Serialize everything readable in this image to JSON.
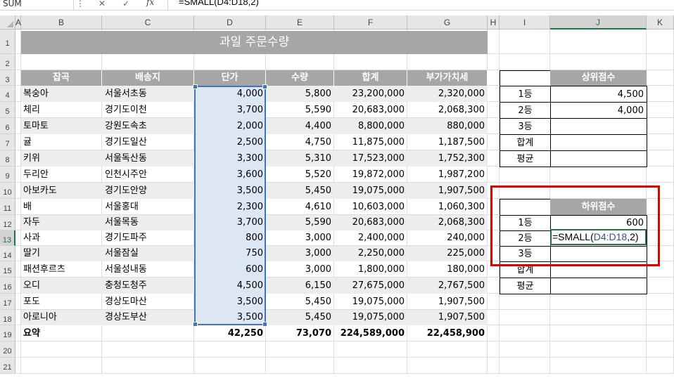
{
  "formula_bar": {
    "name_box": "SUM",
    "cancel": "✕",
    "enter": "✓",
    "fx": "fx",
    "formula": "=SMALL(D4:D18,2)"
  },
  "columns": [
    "A",
    "B",
    "C",
    "D",
    "E",
    "F",
    "G",
    "H",
    "I",
    "J",
    "K"
  ],
  "rows": [
    "1",
    "2",
    "3",
    "4",
    "5",
    "6",
    "7",
    "8",
    "9",
    "10",
    "11",
    "12",
    "13",
    "14",
    "15",
    "16",
    "17",
    "18",
    "19",
    "20",
    "21"
  ],
  "title": "과일 주문수량",
  "headers": [
    "잡곡",
    "배송지",
    "단가",
    "수량",
    "합계",
    "부가가치세"
  ],
  "table": [
    [
      "복숭아",
      "서울서초동",
      "4,000",
      "5,800",
      "23,200,000",
      "2,320,000"
    ],
    [
      "체리",
      "경기도이천",
      "3,700",
      "5,590",
      "20,683,000",
      "2,068,300"
    ],
    [
      "토마토",
      "강원도속초",
      "2,000",
      "4,400",
      "8,800,000",
      "880,000"
    ],
    [
      "귤",
      "경기도일산",
      "2,500",
      "4,750",
      "11,875,000",
      "1,187,500"
    ],
    [
      "키위",
      "서울독산동",
      "3,300",
      "5,310",
      "17,523,000",
      "1,752,300"
    ],
    [
      "두리안",
      "인천시주안",
      "3,600",
      "5,520",
      "19,872,000",
      "1,987,200"
    ],
    [
      "아보카도",
      "경기도안양",
      "3,500",
      "5,450",
      "19,075,000",
      "1,907,500"
    ],
    [
      "배",
      "서울홍대",
      "2,300",
      "4,610",
      "10,603,000",
      "1,060,300"
    ],
    [
      "자두",
      "서울목동",
      "3,700",
      "5,590",
      "20,683,000",
      "2,068,300"
    ],
    [
      "사과",
      "경기도파주",
      "800",
      "3,000",
      "2,400,000",
      "240,000"
    ],
    [
      "딸기",
      "서울잠실",
      "750",
      "3,000",
      "2,250,000",
      "225,000"
    ],
    [
      "패션후르츠",
      "서울성내동",
      "600",
      "3,000",
      "1,800,000",
      "180,000"
    ],
    [
      "오디",
      "충청도청주",
      "4,500",
      "6,150",
      "27,675,000",
      "2,767,500"
    ],
    [
      "포도",
      "경상도마산",
      "3,500",
      "5,450",
      "19,075,000",
      "1,907,500"
    ],
    [
      "아로니아",
      "경상도부산",
      "3,500",
      "5,450",
      "19,075,000",
      "1,907,500"
    ]
  ],
  "summary": {
    "label": "요약",
    "price": "42,250",
    "qty": "73,070",
    "total": "224,589,000",
    "vat": "22,458,900"
  },
  "top_table": {
    "header": "상위점수",
    "rows": [
      {
        "label": "1등",
        "value": "4,500"
      },
      {
        "label": "2등",
        "value": "4,000"
      },
      {
        "label": "3등",
        "value": ""
      },
      {
        "label": "합계",
        "value": ""
      },
      {
        "label": "평균",
        "value": ""
      }
    ]
  },
  "bottom_table": {
    "header": "하위점수",
    "rows": [
      {
        "label": "1등",
        "value": "600"
      },
      {
        "label": "2등",
        "value": ""
      },
      {
        "label": "3등",
        "value": ""
      },
      {
        "label": "합계",
        "value": ""
      },
      {
        "label": "평균",
        "value": ""
      }
    ],
    "editing_prefix": "=SMALL(",
    "editing_ref": "D4:D18",
    "editing_suffix": ",2)"
  },
  "colors": {
    "header_gray": "#a6a6a6",
    "row_shade": "#ededed",
    "selection_blue": "#4472c4",
    "active_green": "#217346",
    "highlight_red": "#e00000"
  }
}
